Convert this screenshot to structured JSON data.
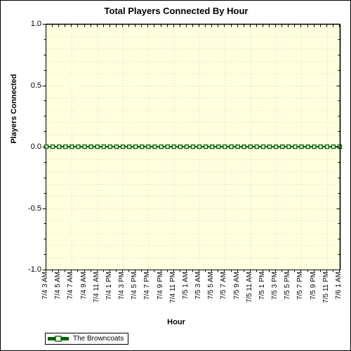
{
  "chart_data": {
    "type": "line",
    "title": "Total Players Connected By Hour",
    "xlabel": "Hour",
    "ylabel": "Players Connected",
    "ylim": [
      -1.0,
      1.0
    ],
    "ytick_labels": [
      "1.0",
      "0.5",
      "0.0",
      "-0.5",
      "-1.0"
    ],
    "ytick_values": [
      1.0,
      0.5,
      0.0,
      -0.5,
      -1.0
    ],
    "y_minor_ticks_per_major": 4,
    "grid": true,
    "grid_style": "dotted",
    "legend_position": "bottom-left",
    "categories": [
      "7/4 3 AM",
      "7/4 4 AM",
      "7/4 5 AM",
      "7/4 6 AM",
      "7/4 7 AM",
      "7/4 8 AM",
      "7/4 9 AM",
      "7/4 10 AM",
      "7/4 11 AM",
      "7/4 12 PM",
      "7/4 1 PM",
      "7/4 2 PM",
      "7/4 3 PM",
      "7/4 4 PM",
      "7/4 5 PM",
      "7/4 6 PM",
      "7/4 7 PM",
      "7/4 8 PM",
      "7/4 9 PM",
      "7/4 10 PM",
      "7/4 11 PM",
      "7/5 12 AM",
      "7/5 1 AM",
      "7/5 2 AM",
      "7/5 3 AM",
      "7/5 4 AM",
      "7/5 5 AM",
      "7/5 6 AM",
      "7/5 7 AM",
      "7/5 8 AM",
      "7/5 9 AM",
      "7/5 10 AM",
      "7/5 11 AM",
      "7/5 12 PM",
      "7/5 1 PM",
      "7/5 2 PM",
      "7/5 3 PM",
      "7/5 4 PM",
      "7/5 5 PM",
      "7/5 6 PM",
      "7/5 7 PM",
      "7/5 8 PM",
      "7/5 9 PM",
      "7/5 10 PM",
      "7/5 11 PM",
      "7/6 12 AM",
      "7/6 1 AM"
    ],
    "xtick_labels": [
      "7/4 3 AM",
      "7/4 5 AM",
      "7/4 7 AM",
      "7/4 9 AM",
      "7/4 11 AM",
      "7/4 1 PM",
      "7/4 3 PM",
      "7/4 5 PM",
      "7/4 7 PM",
      "7/4 9 PM",
      "7/4 11 PM",
      "7/5 1 AM",
      "7/5 3 AM",
      "7/5 5 AM",
      "7/5 7 AM",
      "7/5 9 AM",
      "7/5 11 AM",
      "7/5 1 PM",
      "7/5 3 PM",
      "7/5 5 PM",
      "7/5 7 PM",
      "7/5 9 PM",
      "7/5 11 PM",
      "7/6 1 AM"
    ],
    "series": [
      {
        "name": "The Browncoats",
        "color": "#006400",
        "marker": "square",
        "marker_fill": "#ffffff",
        "values": [
          0,
          0,
          0,
          0,
          0,
          0,
          0,
          0,
          0,
          0,
          0,
          0,
          0,
          0,
          0,
          0,
          0,
          0,
          0,
          0,
          0,
          0,
          0,
          0,
          0,
          0,
          0,
          0,
          0,
          0,
          0,
          0,
          0,
          0,
          0,
          0,
          0,
          0,
          0,
          0,
          0,
          0,
          0,
          0,
          0,
          0,
          0
        ]
      }
    ],
    "colors": {
      "plot_background": "#ffffe0",
      "chart_background": "#ffffff",
      "axis": "#000000",
      "gridline": "#d7d7b0",
      "series_green": "#006400",
      "border": "#000000"
    }
  },
  "legend": {
    "entries": [
      {
        "label": "The Browncoats",
        "color": "#006400"
      }
    ]
  }
}
